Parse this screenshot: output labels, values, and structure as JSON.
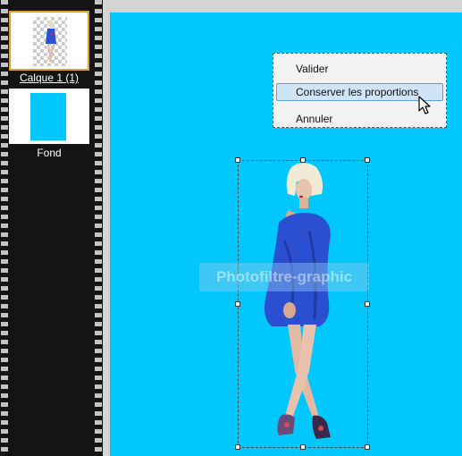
{
  "layers": {
    "items": [
      {
        "label": "Calque 1 (1)",
        "selected": true
      },
      {
        "label": "Fond",
        "selected": false
      }
    ]
  },
  "context_menu": {
    "items": [
      {
        "label": "Valider"
      },
      {
        "label": "Conserver les proportions",
        "highlighted": true
      },
      {
        "label": "Annuler"
      }
    ]
  },
  "canvas": {
    "background": "#00c8ff",
    "watermark": "Photofiltre-graphic"
  },
  "icons": {
    "cursor": "arrow-pointer-icon"
  },
  "colors": {
    "canvas_background": "#00c8ff",
    "menu_highlight": "#cfe4f7",
    "selected_layer_border": "#e0a020",
    "film_strip": "#141414"
  }
}
